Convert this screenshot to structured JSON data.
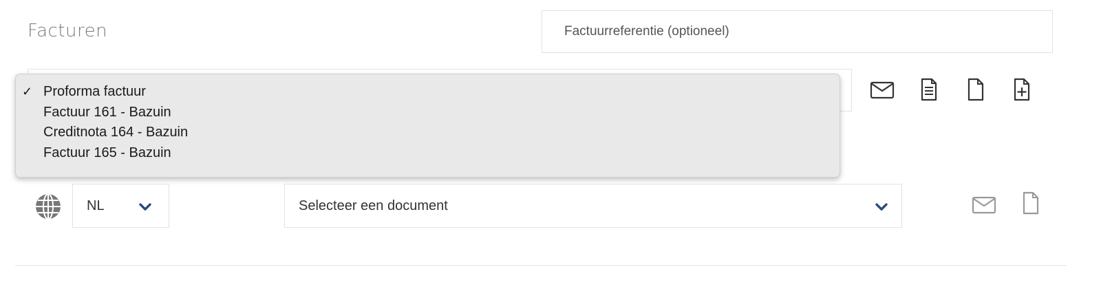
{
  "section": {
    "title": "Facturen"
  },
  "reference": {
    "placeholder": "Factuurreferentie (optioneel)",
    "value": ""
  },
  "invoice_select": {
    "options": [
      {
        "label": "Proforma factuur",
        "selected": true,
        "check": "✓"
      },
      {
        "label": "Factuur 161 - Bazuin",
        "selected": false,
        "check": ""
      },
      {
        "label": "Creditnota 164 - Bazuin",
        "selected": false,
        "check": ""
      },
      {
        "label": "Factuur 165 - Bazuin",
        "selected": false,
        "check": ""
      }
    ]
  },
  "invoice_actions": [
    "envelope-icon",
    "document-lines-icon",
    "file-icon",
    "file-plus-icon"
  ],
  "language": {
    "icon": "globe-icon",
    "value": "NL"
  },
  "document_select": {
    "value": "Selecteer een document"
  },
  "document_actions": [
    "envelope-icon",
    "file-icon"
  ],
  "colors": {
    "chevron": "#2c4a7c",
    "icon": "#333333",
    "icon_muted": "#999999",
    "globe": "#777777"
  }
}
